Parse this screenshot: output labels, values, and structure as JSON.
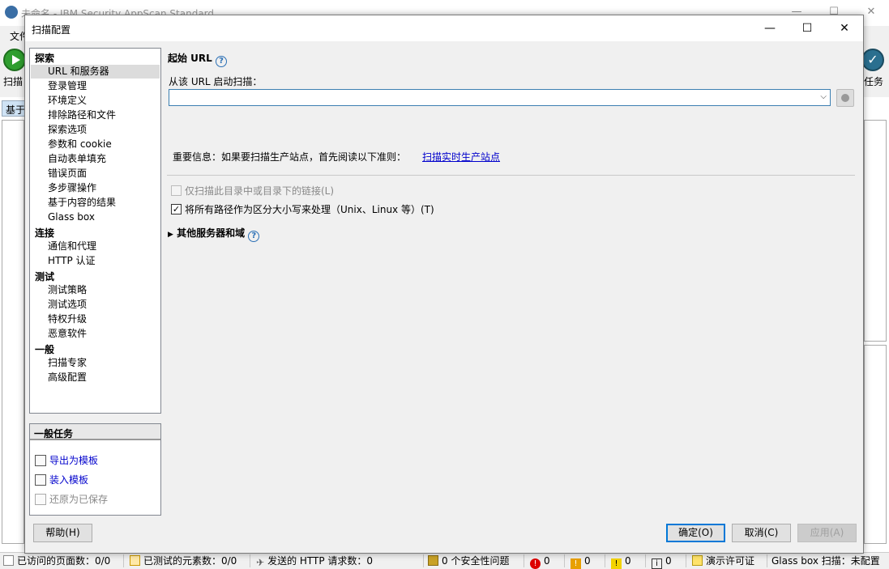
{
  "app": {
    "title": "未命名 - IBM Security AppScan Standard",
    "menu_first": "文件",
    "toolbar_left_label": "扫描",
    "toolbar_right_label": "任务",
    "left_tab": "基于"
  },
  "dialog": {
    "title": "扫描配置",
    "nav": {
      "sections": [
        {
          "label": "探索",
          "items": [
            "URL 和服务器",
            "登录管理",
            "环境定义",
            "排除路径和文件",
            "探索选项",
            "参数和 cookie",
            "自动表单填充",
            "错误页面",
            "多步骤操作",
            "基于内容的结果",
            "Glass box"
          ]
        },
        {
          "label": "连接",
          "items": [
            "通信和代理",
            "HTTP 认证"
          ]
        },
        {
          "label": "测试",
          "items": [
            "测试策略",
            "测试选项",
            "特权升级",
            "恶意软件"
          ]
        },
        {
          "label": "一般",
          "items": [
            "扫描专家",
            "高级配置"
          ]
        }
      ],
      "selected": "URL 和服务器"
    },
    "tasks": {
      "header": "一般任务",
      "items": [
        {
          "label": "导出为模板",
          "enabled": true
        },
        {
          "label": "装入模板",
          "enabled": true
        },
        {
          "label": "还原为已保存",
          "enabled": false
        }
      ]
    },
    "content": {
      "section_title": "起始 URL",
      "url_label": "从该 URL 启动扫描：",
      "url_value": "",
      "info_text": "重要信息：如果要扫描生产站点，首先阅读以下准则：",
      "info_link": "扫描实时生产站点",
      "checkbox1": {
        "label": "仅扫描此目录中或目录下的链接(L)",
        "checked": false,
        "enabled": false
      },
      "checkbox2": {
        "label": "将所有路径作为区分大小写来处理（Unix、Linux 等）(T)",
        "checked": true,
        "enabled": true
      },
      "expander": "其他服务器和域"
    },
    "buttons": {
      "help": "帮助(H)",
      "ok": "确定(O)",
      "cancel": "取消(C)",
      "apply": "应用(A)"
    }
  },
  "status_bar": {
    "visited_pages": "已访问的页面数：0/0",
    "tested_elements": "已测试的元素数：0/0",
    "http_requests": "发送的 HTTP 请求数：0",
    "security_issues": "0 个安全性问题",
    "high": "0",
    "medium": "0",
    "low": "0",
    "info": "0",
    "license": "演示许可证",
    "glassbox": "Glass box 扫描：未配置"
  }
}
